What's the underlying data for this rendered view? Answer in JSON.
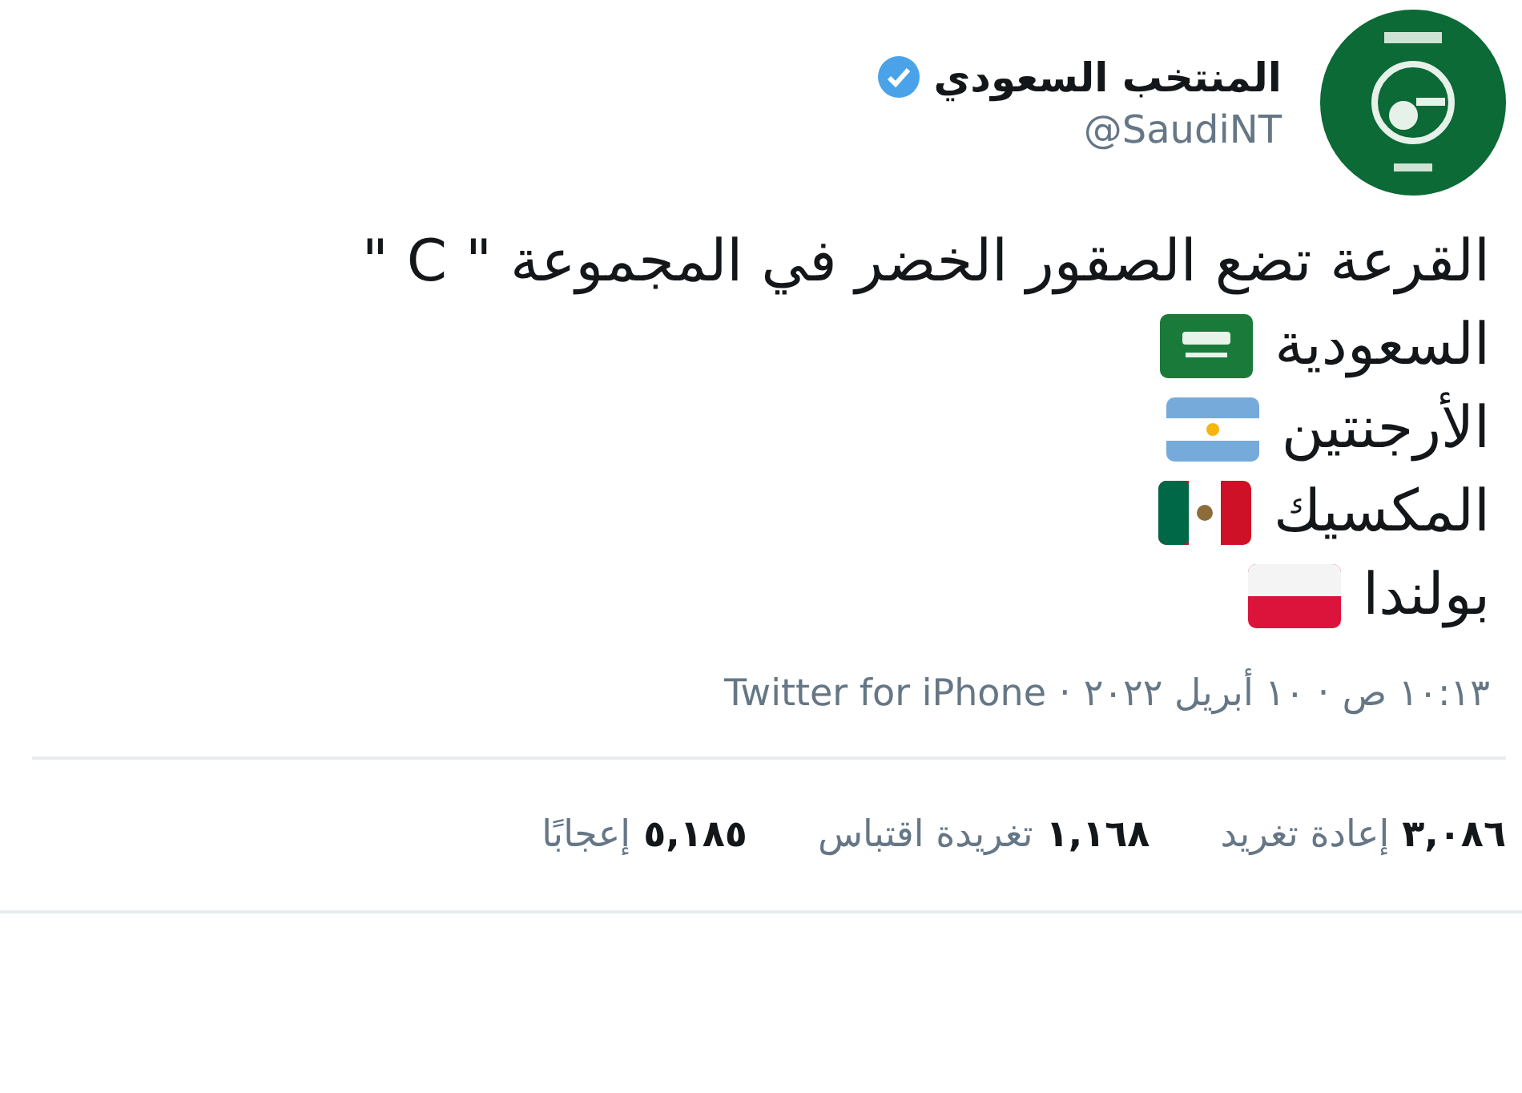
{
  "author": {
    "name": "المنتخب السعودي",
    "verified": true,
    "handle": "@SaudiNT"
  },
  "tweet": {
    "headline": "القرعة تضع الصقور الخضر في المجموعة \" C \"",
    "teams": [
      {
        "name": "السعودية",
        "kind": "saudi"
      },
      {
        "name": "الأرجنتين",
        "kind": "argentina"
      },
      {
        "name": "المكسيك",
        "kind": "mexico"
      },
      {
        "name": "بولندا",
        "kind": "poland"
      }
    ]
  },
  "meta": {
    "time": "١٠:١٣ ص",
    "separator_1": "·",
    "date": "١٠ أبريل ٢٠٢٢",
    "separator_2": "·",
    "source": "Twitter for iPhone"
  },
  "stats": [
    {
      "count": "٣,٠٨٦",
      "label": "إعادة تغريد"
    },
    {
      "count": "١,١٦٨",
      "label": "تغريدة اقتباس"
    },
    {
      "count": "٥,١٨٥",
      "label": "إعجابًا"
    }
  ]
}
